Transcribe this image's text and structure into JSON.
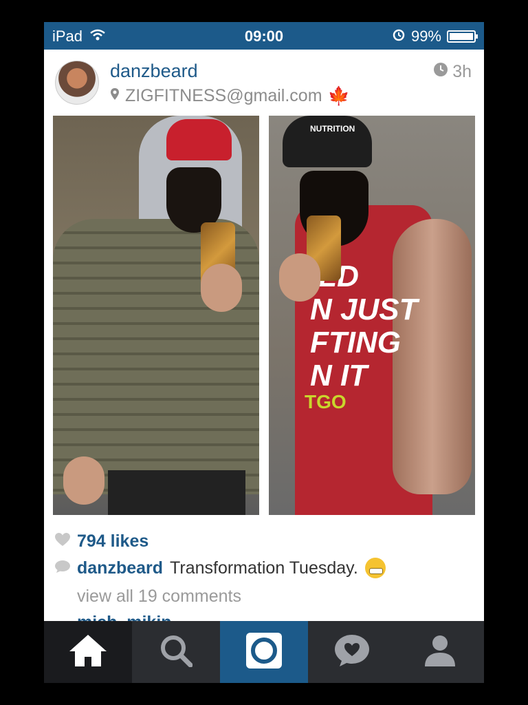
{
  "status_bar": {
    "device": "iPad",
    "time": "09:00",
    "battery": "99%",
    "battery_level": 0.99
  },
  "post": {
    "username": "danzbeard",
    "location": "ZIGFITNESS@gmail.com",
    "time_ago": "3h",
    "images": {
      "right_cap_text": "NUTRITION",
      "tank_text": "ILD\nN JUST\nFTING\nN IT",
      "tank_logo": "TGO"
    },
    "likes": "794 likes",
    "caption_user": "danzbeard",
    "caption_text": "Transformation Tuesday.",
    "view_comments": "view all 19 comments",
    "next_comment_user": "mich_mikin"
  },
  "tabbar": {
    "tabs": [
      {
        "name": "home",
        "icon": "home-icon"
      },
      {
        "name": "explore",
        "icon": "search-icon"
      },
      {
        "name": "camera",
        "icon": "camera-icon"
      },
      {
        "name": "activity",
        "icon": "heart-bubble-icon"
      },
      {
        "name": "profile",
        "icon": "profile-icon"
      }
    ]
  },
  "colors": {
    "accent": "#1c5a8a",
    "link": "#1f5a89",
    "tabbar_bg": "#2b2d31"
  }
}
